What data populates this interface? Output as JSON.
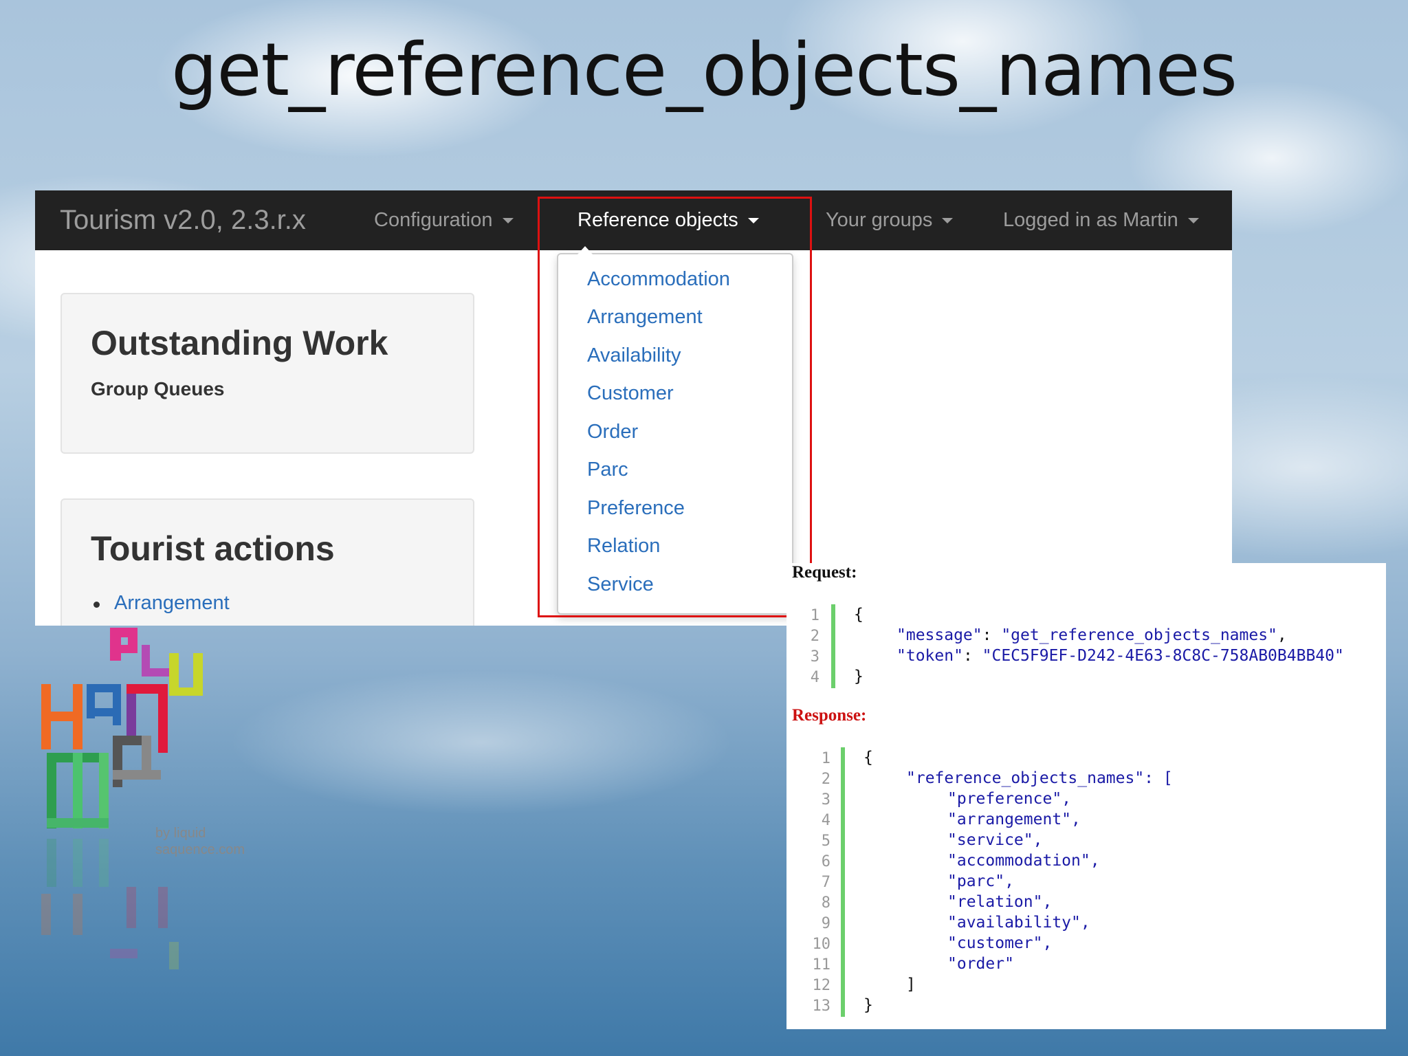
{
  "slide": {
    "title": "get_reference_objects_names"
  },
  "app": {
    "brand": "Tourism v2.0, 2.3.r.x",
    "nav": [
      {
        "label": "Configuration"
      },
      {
        "label": "Reference objects"
      },
      {
        "label": "Your groups"
      },
      {
        "label": "Logged in as Martin"
      }
    ],
    "outstanding": {
      "title": "Outstanding Work",
      "subtitle": "Group Queues"
    },
    "tourist": {
      "title": "Tourist actions",
      "items": [
        "Arrangement"
      ]
    },
    "dropdown": {
      "items": [
        "Accommodation",
        "Arrangement",
        "Availability",
        "Customer",
        "Order",
        "Parc",
        "Preference",
        "Relation",
        "Service"
      ]
    }
  },
  "code": {
    "request_label": "Request:",
    "response_label": "Response:",
    "request_lines": [
      {
        "n": "1",
        "text": "{"
      },
      {
        "n": "2",
        "key": "\"message\"",
        "value": "\"get_reference_objects_names\""
      },
      {
        "n": "3",
        "key": "\"token\"",
        "value": "\"CEC5F9EF-D242-4E63-8C8C-758AB0B4BB40\""
      },
      {
        "n": "4",
        "text": "}"
      }
    ],
    "response_lines": [
      {
        "n": "1",
        "text": "{"
      },
      {
        "n": "2",
        "text": "\"reference_objects_names\": ["
      },
      {
        "n": "3",
        "text": "\"preference\","
      },
      {
        "n": "4",
        "text": "\"arrangement\","
      },
      {
        "n": "5",
        "text": "\"service\","
      },
      {
        "n": "6",
        "text": "\"accommodation\","
      },
      {
        "n": "7",
        "text": "\"parc\","
      },
      {
        "n": "8",
        "text": "\"relation\","
      },
      {
        "n": "9",
        "text": "\"availability\","
      },
      {
        "n": "10",
        "text": "\"customer\","
      },
      {
        "n": "11",
        "text": "\"order\""
      },
      {
        "n": "12",
        "text": "]"
      },
      {
        "n": "13",
        "text": "}"
      }
    ]
  },
  "logo": {
    "credit_line1": "by liquid",
    "credit_line2": "saquence.com"
  },
  "colors": {
    "navbar": "#222222",
    "link": "#2a6ebb",
    "highlight": "#dd1111",
    "code_string": "#1a1aa6",
    "gutter": "#6ccf6c"
  }
}
